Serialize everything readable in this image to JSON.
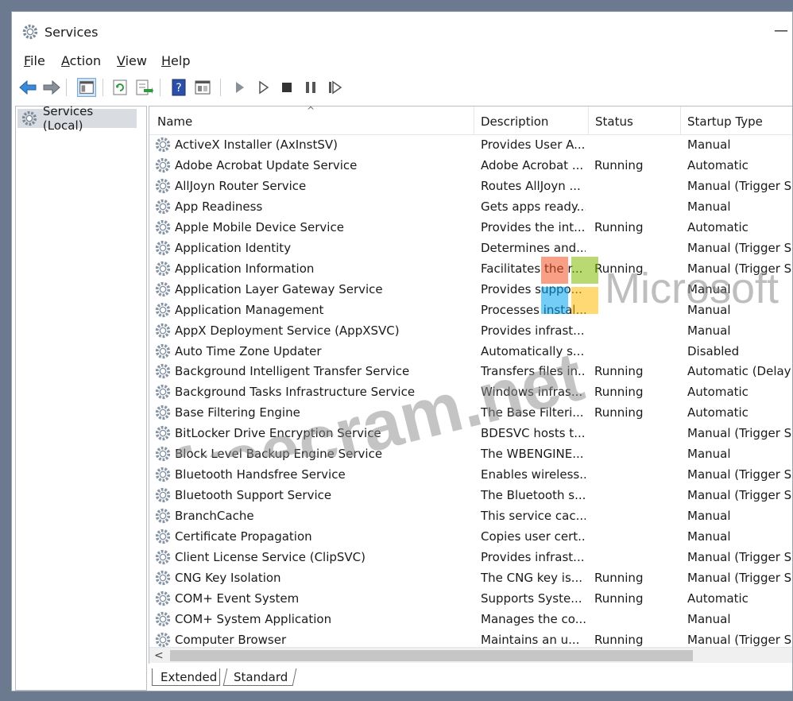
{
  "window": {
    "title": "Services",
    "minimize": "—"
  },
  "menu": [
    {
      "label": "File",
      "u": "F",
      "rest": "ile"
    },
    {
      "label": "Action",
      "u": "A",
      "rest": "ction"
    },
    {
      "label": "View",
      "u": "V",
      "rest": "iew"
    },
    {
      "label": "Help",
      "u": "H",
      "rest": "elp"
    }
  ],
  "tree": {
    "root": "Services (Local)"
  },
  "columns": {
    "name": "Name",
    "description": "Description",
    "status": "Status",
    "startup": "Startup Type",
    "sort_arrow": "^"
  },
  "services": [
    {
      "name": "ActiveX Installer (AxInstSV)",
      "description": "Provides User A...",
      "status": "",
      "startup": "Manual"
    },
    {
      "name": "Adobe Acrobat Update Service",
      "description": "Adobe Acrobat ...",
      "status": "Running",
      "startup": "Automatic"
    },
    {
      "name": "AllJoyn Router Service",
      "description": "Routes AllJoyn ...",
      "status": "",
      "startup": "Manual (Trigger S"
    },
    {
      "name": "App Readiness",
      "description": "Gets apps ready...",
      "status": "",
      "startup": "Manual"
    },
    {
      "name": "Apple Mobile Device Service",
      "description": "Provides the int...",
      "status": "Running",
      "startup": "Automatic"
    },
    {
      "name": "Application Identity",
      "description": "Determines and...",
      "status": "",
      "startup": "Manual (Trigger S"
    },
    {
      "name": "Application Information",
      "description": "Facilitates the r...",
      "status": "Running",
      "startup": "Manual (Trigger S"
    },
    {
      "name": "Application Layer Gateway Service",
      "description": "Provides suppo...",
      "status": "",
      "startup": "Manual"
    },
    {
      "name": "Application Management",
      "description": "Processes instal...",
      "status": "",
      "startup": "Manual"
    },
    {
      "name": "AppX Deployment Service (AppXSVC)",
      "description": "Provides infrast...",
      "status": "",
      "startup": "Manual"
    },
    {
      "name": "Auto Time Zone Updater",
      "description": "Automatically s...",
      "status": "",
      "startup": "Disabled"
    },
    {
      "name": "Background Intelligent Transfer Service",
      "description": "Transfers files in...",
      "status": "Running",
      "startup": "Automatic (Delay"
    },
    {
      "name": "Background Tasks Infrastructure Service",
      "description": "Windows infras...",
      "status": "Running",
      "startup": "Automatic"
    },
    {
      "name": "Base Filtering Engine",
      "description": "The Base Filteri...",
      "status": "Running",
      "startup": "Automatic"
    },
    {
      "name": "BitLocker Drive Encryption Service",
      "description": "BDESVC hosts t...",
      "status": "",
      "startup": "Manual (Trigger S"
    },
    {
      "name": "Block Level Backup Engine Service",
      "description": "The WBENGINE...",
      "status": "",
      "startup": "Manual"
    },
    {
      "name": "Bluetooth Handsfree Service",
      "description": "Enables wireless...",
      "status": "",
      "startup": "Manual (Trigger S"
    },
    {
      "name": "Bluetooth Support Service",
      "description": "The Bluetooth s...",
      "status": "",
      "startup": "Manual (Trigger S"
    },
    {
      "name": "BranchCache",
      "description": "This service cac...",
      "status": "",
      "startup": "Manual"
    },
    {
      "name": "Certificate Propagation",
      "description": "Copies user cert...",
      "status": "",
      "startup": "Manual"
    },
    {
      "name": "Client License Service (ClipSVC)",
      "description": "Provides infrast...",
      "status": "",
      "startup": "Manual (Trigger S"
    },
    {
      "name": "CNG Key Isolation",
      "description": "The CNG key is...",
      "status": "Running",
      "startup": "Manual (Trigger S"
    },
    {
      "name": "COM+ Event System",
      "description": "Supports Syste...",
      "status": "Running",
      "startup": "Automatic"
    },
    {
      "name": "COM+ System Application",
      "description": "Manages the co...",
      "status": "",
      "startup": "Manual"
    },
    {
      "name": "Computer Browser",
      "description": "Maintains an u...",
      "status": "Running",
      "startup": "Manual (Trigger S"
    }
  ],
  "scroll": {
    "left_arrow": "<"
  },
  "tabs": {
    "extended": "Extended",
    "standard": "Standard"
  },
  "watermark": {
    "text": "freecram.net",
    "brand": "Microsoft"
  },
  "colors": {
    "nav_blue": "#3b8ad9",
    "nav_green": "#6b8e23",
    "stop": "#333333",
    "help_blue": "#2b4fa8"
  }
}
